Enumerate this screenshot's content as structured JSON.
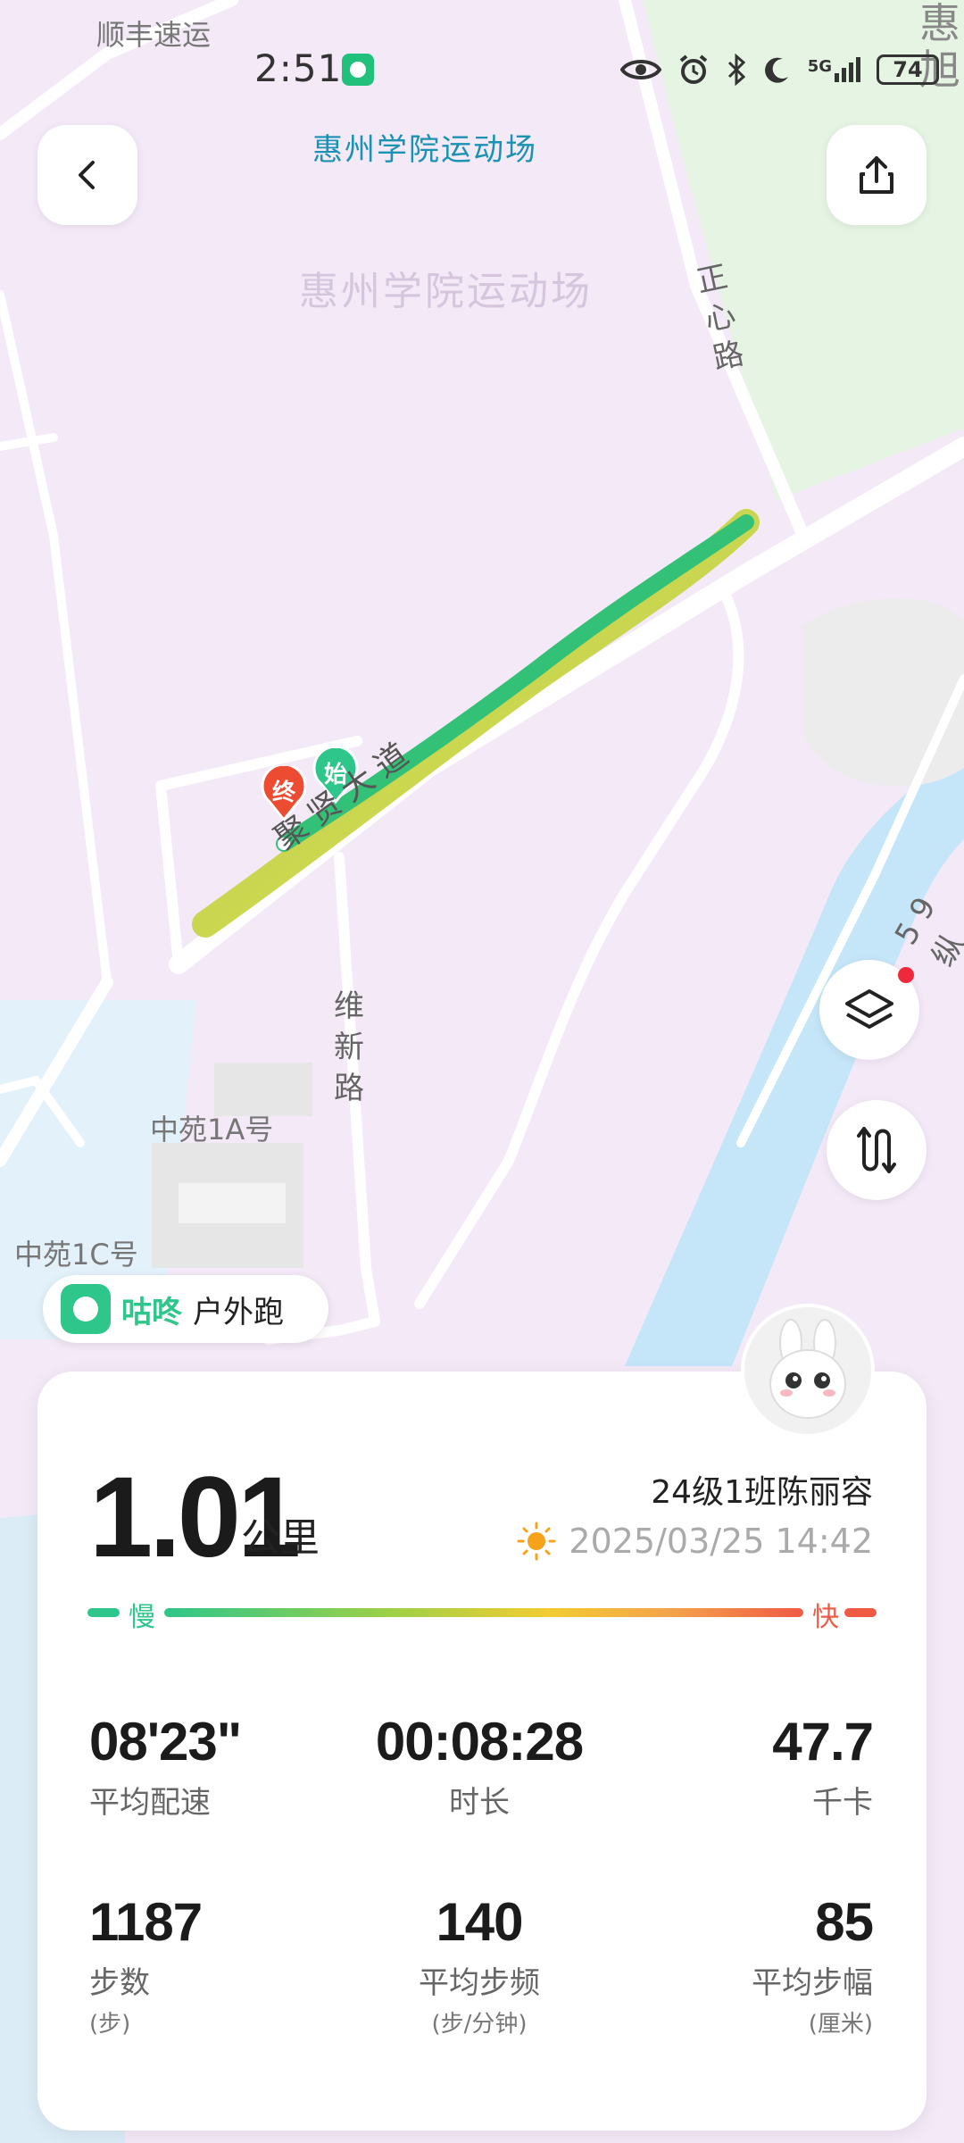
{
  "status_bar": {
    "time": "2:51",
    "network": "5G",
    "battery": "74"
  },
  "map": {
    "title": "惠州学院运动场",
    "area_label": "惠州学院运动场",
    "poi_top": "顺丰速运",
    "corner_chars": "惠\n旭",
    "roads": {
      "zhengxin": "正\n心\n路",
      "juxian": "聚贤大道",
      "weixin": "维\n新\n路",
      "right_fragment": "5 9 纵"
    },
    "buildings": [
      "中苑1A号",
      "中苑1C号"
    ],
    "markers": {
      "start": "始",
      "end": "终"
    }
  },
  "app_badge": {
    "brand": "咕咚",
    "type": "户外跑"
  },
  "summary": {
    "distance": "1.01",
    "distance_unit": "公里",
    "user": "24级1班陈丽容",
    "datetime": "2025/03/25 14:42",
    "pace_slow": "慢",
    "pace_fast": "快"
  },
  "stats": [
    {
      "value": "08'23\"",
      "label": "平均配速",
      "unit": ""
    },
    {
      "value": "00:08:28",
      "label": "时长",
      "unit": ""
    },
    {
      "value": "47.7",
      "label": "千卡",
      "unit": ""
    },
    {
      "value": "1187",
      "label": "步数",
      "unit": "(步)"
    },
    {
      "value": "140",
      "label": "平均步频",
      "unit": "(步/分钟)"
    },
    {
      "value": "85",
      "label": "平均步幅",
      "unit": "(厘米)"
    }
  ],
  "colors": {
    "accent_green": "#2ec68a",
    "map_bg": "#f3e9f7",
    "water": "#c5e6f8",
    "park": "#e6f5e3",
    "pace_slow": "#2ec68a",
    "pace_fast": "#f05a45"
  },
  "icons": [
    "back-icon",
    "share-icon",
    "layers-icon",
    "route-icon",
    "sun-icon",
    "app-logo-icon",
    "eye-icon",
    "alarm-icon",
    "bluetooth-icon",
    "moon-icon",
    "signal-icon"
  ]
}
